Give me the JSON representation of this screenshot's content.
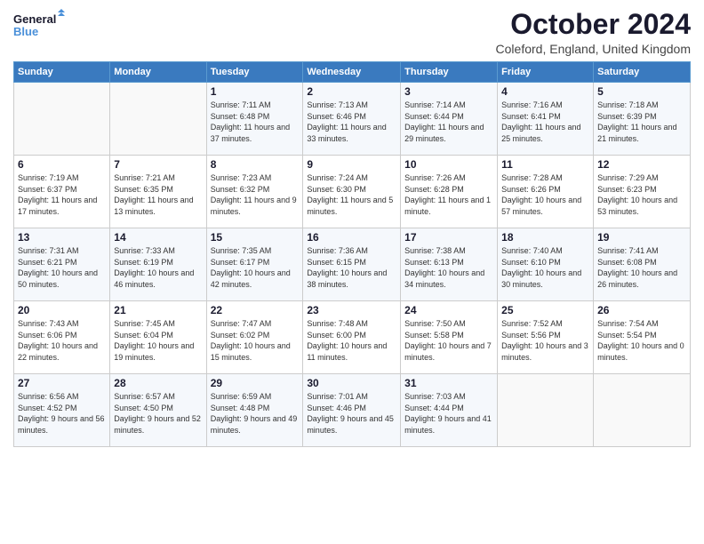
{
  "logo": {
    "line1": "General",
    "line2": "Blue"
  },
  "title": "October 2024",
  "location": "Coleford, England, United Kingdom",
  "days_of_week": [
    "Sunday",
    "Monday",
    "Tuesday",
    "Wednesday",
    "Thursday",
    "Friday",
    "Saturday"
  ],
  "weeks": [
    [
      {
        "day": "",
        "info": ""
      },
      {
        "day": "",
        "info": ""
      },
      {
        "day": "1",
        "info": "Sunrise: 7:11 AM\nSunset: 6:48 PM\nDaylight: 11 hours and 37 minutes."
      },
      {
        "day": "2",
        "info": "Sunrise: 7:13 AM\nSunset: 6:46 PM\nDaylight: 11 hours and 33 minutes."
      },
      {
        "day": "3",
        "info": "Sunrise: 7:14 AM\nSunset: 6:44 PM\nDaylight: 11 hours and 29 minutes."
      },
      {
        "day": "4",
        "info": "Sunrise: 7:16 AM\nSunset: 6:41 PM\nDaylight: 11 hours and 25 minutes."
      },
      {
        "day": "5",
        "info": "Sunrise: 7:18 AM\nSunset: 6:39 PM\nDaylight: 11 hours and 21 minutes."
      }
    ],
    [
      {
        "day": "6",
        "info": "Sunrise: 7:19 AM\nSunset: 6:37 PM\nDaylight: 11 hours and 17 minutes."
      },
      {
        "day": "7",
        "info": "Sunrise: 7:21 AM\nSunset: 6:35 PM\nDaylight: 11 hours and 13 minutes."
      },
      {
        "day": "8",
        "info": "Sunrise: 7:23 AM\nSunset: 6:32 PM\nDaylight: 11 hours and 9 minutes."
      },
      {
        "day": "9",
        "info": "Sunrise: 7:24 AM\nSunset: 6:30 PM\nDaylight: 11 hours and 5 minutes."
      },
      {
        "day": "10",
        "info": "Sunrise: 7:26 AM\nSunset: 6:28 PM\nDaylight: 11 hours and 1 minute."
      },
      {
        "day": "11",
        "info": "Sunrise: 7:28 AM\nSunset: 6:26 PM\nDaylight: 10 hours and 57 minutes."
      },
      {
        "day": "12",
        "info": "Sunrise: 7:29 AM\nSunset: 6:23 PM\nDaylight: 10 hours and 53 minutes."
      }
    ],
    [
      {
        "day": "13",
        "info": "Sunrise: 7:31 AM\nSunset: 6:21 PM\nDaylight: 10 hours and 50 minutes."
      },
      {
        "day": "14",
        "info": "Sunrise: 7:33 AM\nSunset: 6:19 PM\nDaylight: 10 hours and 46 minutes."
      },
      {
        "day": "15",
        "info": "Sunrise: 7:35 AM\nSunset: 6:17 PM\nDaylight: 10 hours and 42 minutes."
      },
      {
        "day": "16",
        "info": "Sunrise: 7:36 AM\nSunset: 6:15 PM\nDaylight: 10 hours and 38 minutes."
      },
      {
        "day": "17",
        "info": "Sunrise: 7:38 AM\nSunset: 6:13 PM\nDaylight: 10 hours and 34 minutes."
      },
      {
        "day": "18",
        "info": "Sunrise: 7:40 AM\nSunset: 6:10 PM\nDaylight: 10 hours and 30 minutes."
      },
      {
        "day": "19",
        "info": "Sunrise: 7:41 AM\nSunset: 6:08 PM\nDaylight: 10 hours and 26 minutes."
      }
    ],
    [
      {
        "day": "20",
        "info": "Sunrise: 7:43 AM\nSunset: 6:06 PM\nDaylight: 10 hours and 22 minutes."
      },
      {
        "day": "21",
        "info": "Sunrise: 7:45 AM\nSunset: 6:04 PM\nDaylight: 10 hours and 19 minutes."
      },
      {
        "day": "22",
        "info": "Sunrise: 7:47 AM\nSunset: 6:02 PM\nDaylight: 10 hours and 15 minutes."
      },
      {
        "day": "23",
        "info": "Sunrise: 7:48 AM\nSunset: 6:00 PM\nDaylight: 10 hours and 11 minutes."
      },
      {
        "day": "24",
        "info": "Sunrise: 7:50 AM\nSunset: 5:58 PM\nDaylight: 10 hours and 7 minutes."
      },
      {
        "day": "25",
        "info": "Sunrise: 7:52 AM\nSunset: 5:56 PM\nDaylight: 10 hours and 3 minutes."
      },
      {
        "day": "26",
        "info": "Sunrise: 7:54 AM\nSunset: 5:54 PM\nDaylight: 10 hours and 0 minutes."
      }
    ],
    [
      {
        "day": "27",
        "info": "Sunrise: 6:56 AM\nSunset: 4:52 PM\nDaylight: 9 hours and 56 minutes."
      },
      {
        "day": "28",
        "info": "Sunrise: 6:57 AM\nSunset: 4:50 PM\nDaylight: 9 hours and 52 minutes."
      },
      {
        "day": "29",
        "info": "Sunrise: 6:59 AM\nSunset: 4:48 PM\nDaylight: 9 hours and 49 minutes."
      },
      {
        "day": "30",
        "info": "Sunrise: 7:01 AM\nSunset: 4:46 PM\nDaylight: 9 hours and 45 minutes."
      },
      {
        "day": "31",
        "info": "Sunrise: 7:03 AM\nSunset: 4:44 PM\nDaylight: 9 hours and 41 minutes."
      },
      {
        "day": "",
        "info": ""
      },
      {
        "day": "",
        "info": ""
      }
    ]
  ]
}
